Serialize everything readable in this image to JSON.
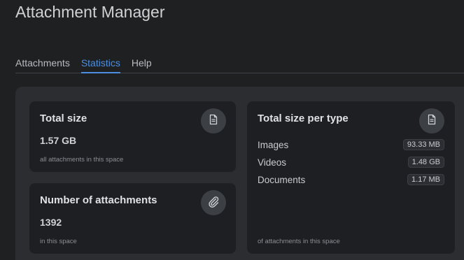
{
  "app": {
    "title": "Attachment Manager"
  },
  "tabs": [
    {
      "label": "Attachments",
      "active": false
    },
    {
      "label": "Statistics",
      "active": true
    },
    {
      "label": "Help",
      "active": false
    }
  ],
  "cards": {
    "total_size": {
      "title": "Total size",
      "value": "1.57 GB",
      "caption": "all attachments in this space",
      "icon": "document-icon"
    },
    "count": {
      "title": "Number of attachments",
      "value": "1392",
      "caption": "in this space",
      "icon": "paperclip-icon"
    },
    "per_type": {
      "title": "Total size per type",
      "caption": "of attachments in this space",
      "icon": "document-icon",
      "rows": [
        {
          "label": "Images",
          "value": "93.33 MB"
        },
        {
          "label": "Videos",
          "value": "1.48 GB"
        },
        {
          "label": "Documents",
          "value": "1.17 MB"
        }
      ]
    }
  },
  "colors": {
    "background": "#1f2022",
    "panel": "#2b2d31",
    "card": "#1e1f22",
    "accent": "#4c8fe0"
  }
}
